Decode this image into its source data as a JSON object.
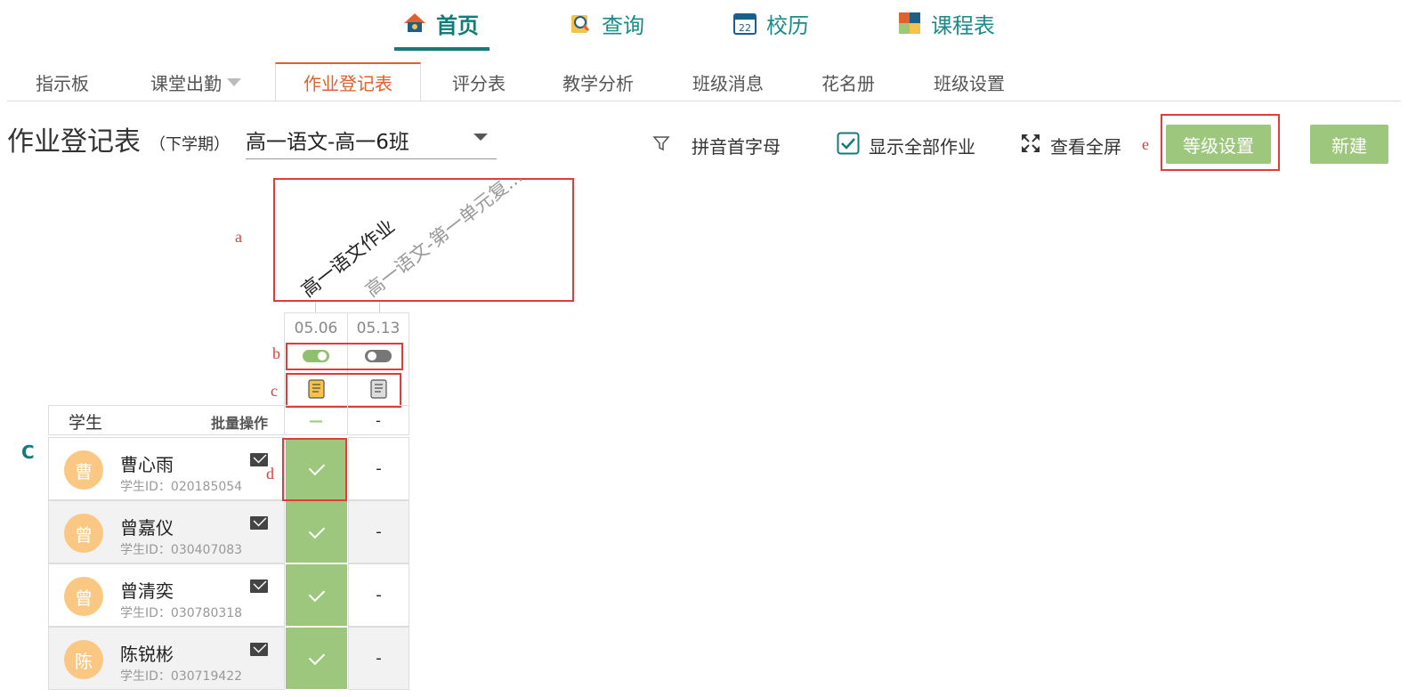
{
  "topnav": [
    {
      "label": "首页",
      "icon": "home-icon",
      "active": true
    },
    {
      "label": "查询",
      "icon": "search-icon",
      "active": false
    },
    {
      "label": "校历",
      "icon": "calendar-icon",
      "calendar_day": "22",
      "active": false
    },
    {
      "label": "课程表",
      "icon": "timetable-icon",
      "active": false
    }
  ],
  "tabs": [
    {
      "label": "指示板"
    },
    {
      "label": "课堂出勤"
    },
    {
      "label": "作业登记表",
      "active": true
    },
    {
      "label": "评分表"
    },
    {
      "label": "教学分析"
    },
    {
      "label": "班级消息"
    },
    {
      "label": "花名册"
    },
    {
      "label": "班级设置"
    }
  ],
  "page": {
    "title": "作业登记表",
    "term": "（下学期）",
    "class_select": "高一语文-高一6班"
  },
  "toolbar": {
    "pinyin": "拼音首字母",
    "show_all": "显示全部作业",
    "show_all_checked": true,
    "fullscreen": "查看全屏",
    "grade_settings": "等级设置",
    "new": "新建"
  },
  "annotations": {
    "a": "a",
    "b": "b",
    "c": "c",
    "C": "C",
    "d": "d",
    "e": "e"
  },
  "assignments": [
    {
      "name": "高一语文作业",
      "date": "05.06",
      "published": true,
      "batch": "—"
    },
    {
      "name": "高一语文-第一单元复...",
      "date": "05.13",
      "published": false,
      "batch": "-"
    }
  ],
  "table_header": {
    "student": "学生",
    "batch": "批量操作"
  },
  "students": [
    {
      "name": "曹心雨",
      "avatar": "曹",
      "id": "学生ID：020185054",
      "col1": "done",
      "col2": "-"
    },
    {
      "name": "曾嘉仪",
      "avatar": "曾",
      "id": "学生ID：030407083",
      "col1": "done",
      "col2": "-"
    },
    {
      "name": "曾清奕",
      "avatar": "曾",
      "id": "学生ID：030780318",
      "col1": "done",
      "col2": "-"
    },
    {
      "name": "陈锐彬",
      "avatar": "陈",
      "id": "学生ID：030719422",
      "col1": "done",
      "col2": "-"
    }
  ],
  "colors": {
    "teal": "#147a7a",
    "orange": "#e0612e",
    "green": "#9dc77d",
    "red": "#e23b3b",
    "avatar": "#fbc883"
  }
}
